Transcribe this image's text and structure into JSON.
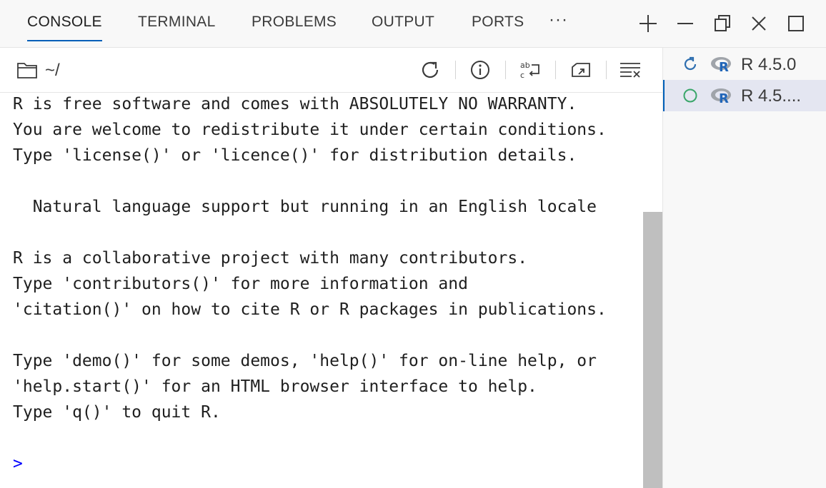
{
  "tabs": [
    {
      "label": "CONSOLE",
      "active": true
    },
    {
      "label": "TERMINAL",
      "active": false
    },
    {
      "label": "PROBLEMS",
      "active": false
    },
    {
      "label": "OUTPUT",
      "active": false
    },
    {
      "label": "PORTS",
      "active": false
    }
  ],
  "more_label": "···",
  "window_controls": [
    "plus-icon",
    "minimize-icon",
    "restore-icon",
    "close-icon",
    "maximize-icon"
  ],
  "console_header": {
    "path": "~/",
    "icons": [
      "folder-icon",
      "refresh-icon",
      "info-icon",
      "word-wrap-icon",
      "open-in-editor-icon",
      "clear-console-icon"
    ]
  },
  "console_lines": [
    "R is free software and comes with ABSOLUTELY NO WARRANTY.",
    "You are welcome to redistribute it under certain conditions.",
    "Type 'license()' or 'licence()' for distribution details.",
    "",
    "  Natural language support but running in an English locale",
    "",
    "R is a collaborative project with many contributors.",
    "Type 'contributors()' for more information and",
    "'citation()' on how to cite R or R packages in publications.",
    "",
    "Type 'demo()' for some demos, 'help()' for on-line help, or",
    "'help.start()' for an HTML browser interface to help.",
    "Type 'q()' to quit R."
  ],
  "prompt": ">",
  "sessions": [
    {
      "label": "R 4.5.0",
      "state": "restarting",
      "selected": false
    },
    {
      "label": "R 4.5....",
      "state": "idle",
      "selected": true
    }
  ],
  "colors": {
    "accent": "#005fb8",
    "prompt": "#0000ff",
    "restart_icon": "#2f6fb0",
    "idle_icon": "#3aa66a",
    "r_logo_blue": "#2266b8",
    "r_logo_gray": "#a0a4aa"
  }
}
